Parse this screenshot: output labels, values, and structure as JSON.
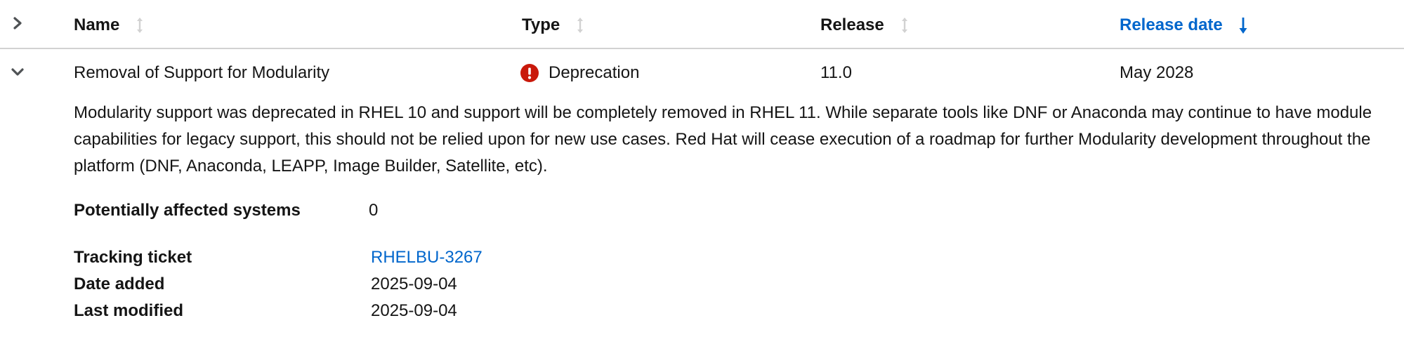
{
  "table": {
    "columns": [
      {
        "label": "Name",
        "sort": "none"
      },
      {
        "label": "Type",
        "sort": "none"
      },
      {
        "label": "Release",
        "sort": "none"
      },
      {
        "label": "Release date",
        "sort": "descending"
      }
    ],
    "colors": {
      "active_sort": "#0066cc",
      "inactive_sort_icon": "#d2d2d2",
      "danger_icon": "#c9190b",
      "link": "#0066cc",
      "border": "#d2d2d2"
    },
    "rows": [
      {
        "expanded": true,
        "name": "Removal of Support for Modularity",
        "type": {
          "label": "Deprecation",
          "icon": "exclamation-circle-icon"
        },
        "release": "11.0",
        "release_date": "May 2028",
        "details": {
          "description": "Modularity support was deprecated in RHEL 10 and support will be completely removed in RHEL 11. While separate tools like DNF or Anaconda may continue to have module capabilities for legacy support, this should not be relied upon for new use cases. Red Hat will cease execution of a roadmap for further Modularity development throughout the platform (DNF, Anaconda, LEAPP, Image Builder, Satellite, etc).",
          "affected_label": "Potentially affected systems",
          "affected_value": "0",
          "ticket_label": "Tracking ticket",
          "ticket_value": "RHELBU-3267",
          "date_added_label": "Date added",
          "date_added_value": "2025-09-04",
          "last_modified_label": "Last modified",
          "last_modified_value": "2025-09-04"
        }
      }
    ]
  }
}
